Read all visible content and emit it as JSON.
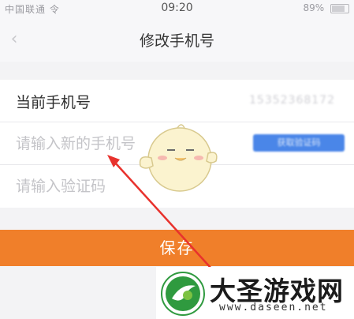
{
  "status_bar": {
    "carrier": "中国联通 令",
    "time": "09:20",
    "battery_pct": "89%"
  },
  "nav": {
    "title": "修改手机号",
    "back_icon": "chevron-left-icon"
  },
  "form": {
    "current_label": "当前手机号",
    "current_number": "15352368172",
    "new_phone_placeholder": "请输入新的手机号",
    "get_code_label": "获取验证码",
    "code_placeholder": "请输入验证码"
  },
  "save_label": "保存",
  "colors": {
    "accent": "#f07f2a",
    "button_blue": "#4a86e8",
    "arrow_red": "#e8322d"
  },
  "watermark": {
    "title": "大圣游戏网",
    "url": "www.daseen.net"
  }
}
